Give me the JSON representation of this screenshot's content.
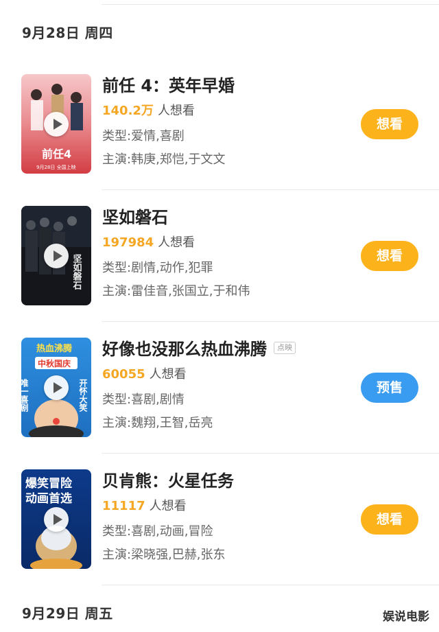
{
  "dates": [
    "9月28日 周四",
    "9月29日 周五"
  ],
  "movies": [
    {
      "title": "前任 4：英年早婚",
      "tag": "",
      "want_count": "140.2万",
      "want_suffix": "人想看",
      "genre": "类型:爱情,喜剧",
      "cast": "主演:韩庚,郑恺,于文文",
      "button": "想看",
      "poster_text": [
        "前任4",
        "9月28日 全国上映"
      ]
    },
    {
      "title": "坚如磐石",
      "tag": "",
      "want_count": "197984",
      "want_suffix": "人想看",
      "genre": "类型:剧情,动作,犯罪",
      "cast": "主演:雷佳音,张国立,于和伟",
      "button": "想看",
      "poster_text": [
        "坚如磐石"
      ]
    },
    {
      "title": "好像也没那么热血沸腾",
      "tag": "点映",
      "want_count": "60055",
      "want_suffix": "人想看",
      "genre": "类型:喜剧,剧情",
      "cast": "主演:魏翔,王智,岳亮",
      "button": "预售",
      "poster_text": [
        "热血沸腾",
        "中秋国庆",
        "唯一喜剧",
        "开怀大笑"
      ]
    },
    {
      "title": "贝肯熊：火星任务",
      "tag": "",
      "want_count": "11117",
      "want_suffix": "人想看",
      "genre": "类型:喜剧,动画,冒险",
      "cast": "主演:梁晓强,巴赫,张东",
      "button": "想看",
      "poster_text": [
        "爆笑冒险",
        "动画首选"
      ]
    }
  ],
  "watermark": "娱说电影",
  "colors": {
    "want_button": "#fbb21b",
    "presale_button": "#3a9cf0",
    "want_count": "#f5a623"
  }
}
